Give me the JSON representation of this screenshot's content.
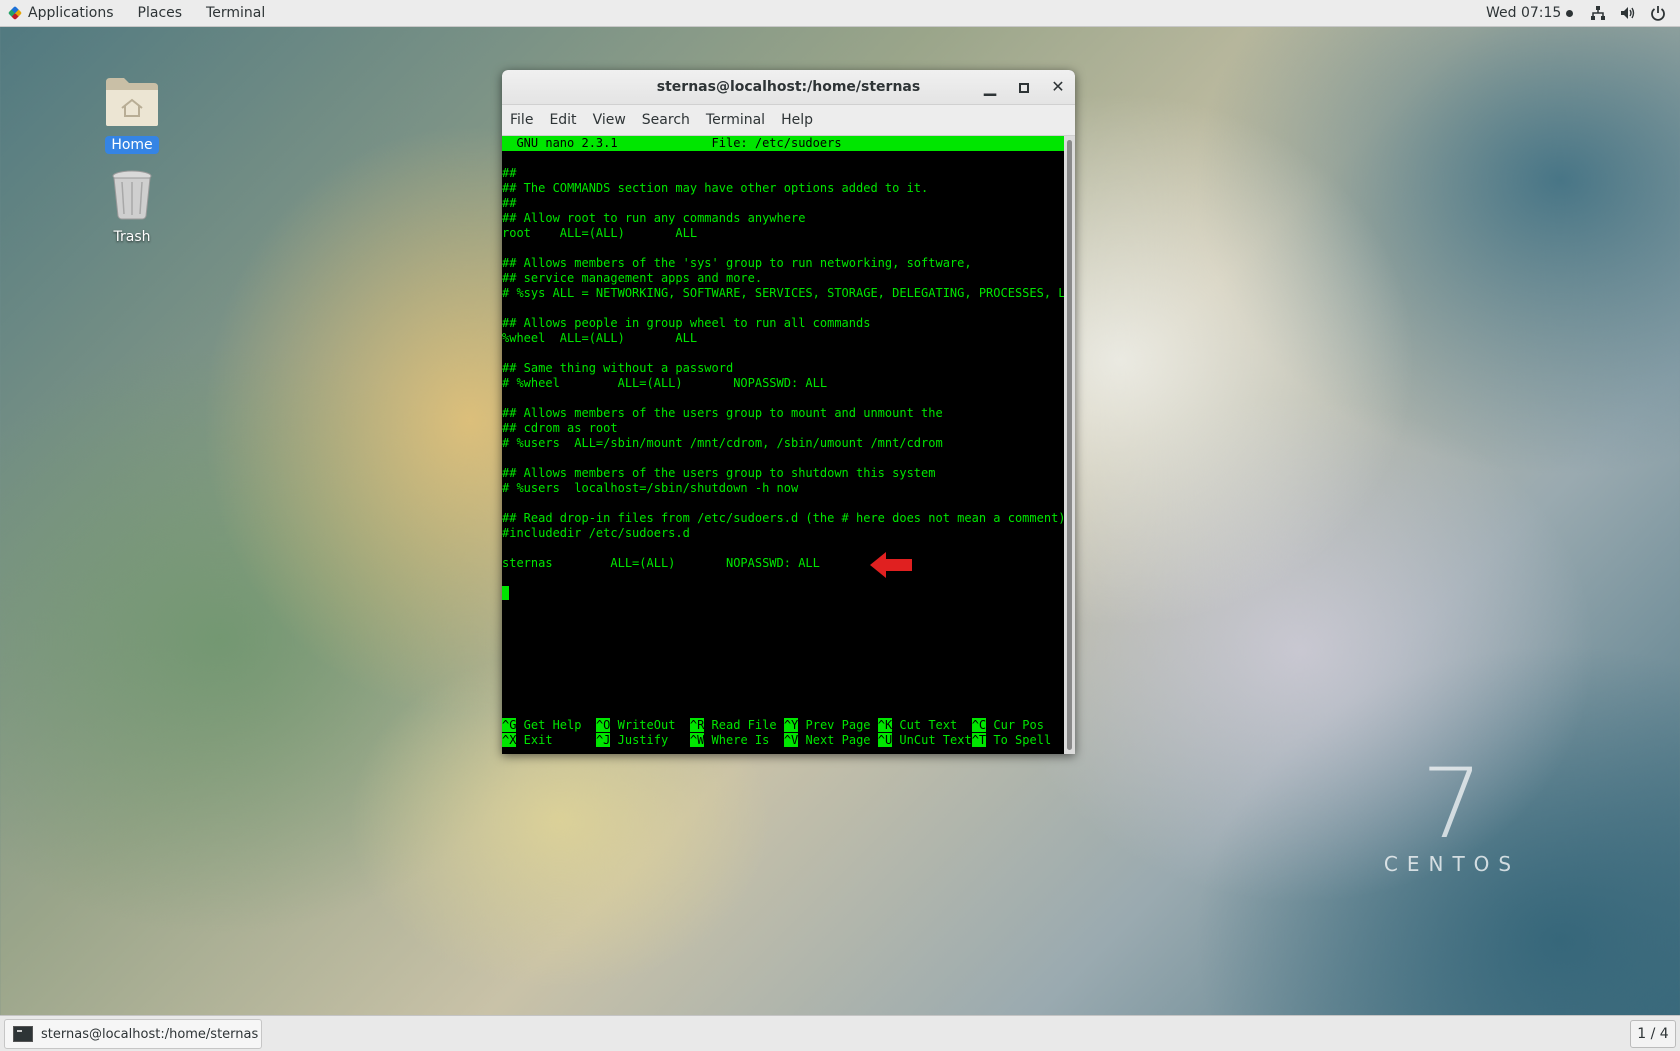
{
  "topbar": {
    "applications": "Applications",
    "places": "Places",
    "terminal": "Terminal",
    "clock": "Wed 07:15"
  },
  "desktop": {
    "home_label": "Home",
    "trash_label": "Trash"
  },
  "window": {
    "title": "sternas@localhost:/home/sternas",
    "menu": [
      "File",
      "Edit",
      "View",
      "Search",
      "Terminal",
      "Help"
    ]
  },
  "nano": {
    "header": "  GNU nano 2.3.1             File: /etc/sudoers                                   ",
    "lines": [
      "",
      "##",
      "## The COMMANDS section may have other options added to it.",
      "##",
      "## Allow root to run any commands anywhere",
      "root    ALL=(ALL)       ALL",
      "",
      "## Allows members of the 'sys' group to run networking, software,",
      "## service management apps and more.",
      "# %sys ALL = NETWORKING, SOFTWARE, SERVICES, STORAGE, DELEGATING, PROCESSES, LO$",
      "",
      "## Allows people in group wheel to run all commands",
      "%wheel  ALL=(ALL)       ALL",
      "",
      "## Same thing without a password",
      "# %wheel        ALL=(ALL)       NOPASSWD: ALL",
      "",
      "## Allows members of the users group to mount and unmount the",
      "## cdrom as root",
      "# %users  ALL=/sbin/mount /mnt/cdrom, /sbin/umount /mnt/cdrom",
      "",
      "## Allows members of the users group to shutdown this system",
      "# %users  localhost=/sbin/shutdown -h now",
      "",
      "## Read drop-in files from /etc/sudoers.d (the # here does not mean a comment)",
      "#includedir /etc/sudoers.d",
      "",
      "sternas        ALL=(ALL)       NOPASSWD: ALL",
      ""
    ],
    "shortcuts_row1": [
      {
        "key": "^G",
        "label": " Get Help  "
      },
      {
        "key": "^O",
        "label": " WriteOut  "
      },
      {
        "key": "^R",
        "label": " Read File "
      },
      {
        "key": "^Y",
        "label": " Prev Page "
      },
      {
        "key": "^K",
        "label": " Cut Text  "
      },
      {
        "key": "^C",
        "label": " Cur Pos"
      }
    ],
    "shortcuts_row2": [
      {
        "key": "^X",
        "label": " Exit      "
      },
      {
        "key": "^J",
        "label": " Justify   "
      },
      {
        "key": "^W",
        "label": " Where Is  "
      },
      {
        "key": "^V",
        "label": " Next Page "
      },
      {
        "key": "^U",
        "label": " UnCut Text"
      },
      {
        "key": "^T",
        "label": " To Spell"
      }
    ]
  },
  "logo": {
    "number": "7",
    "word": "CENTOS"
  },
  "taskbar": {
    "task_label": "sternas@localhost:/home/sternas",
    "workspace": "1 / 4"
  },
  "colors": {
    "terminal_fg": "#00e600",
    "terminal_bg": "#000000",
    "arrow": "#e02020",
    "selection": "#3584e4"
  }
}
